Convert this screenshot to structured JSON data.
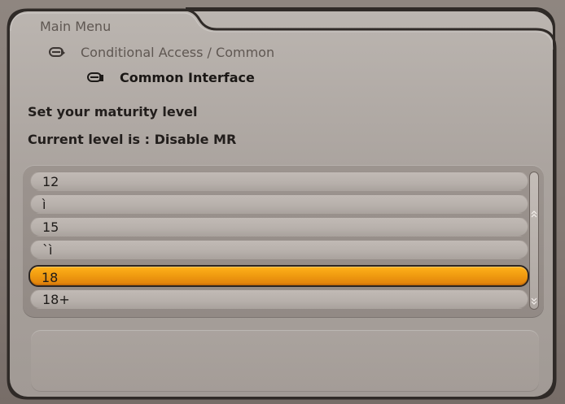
{
  "breadcrumb": {
    "items": [
      {
        "label": "Main Menu"
      },
      {
        "label": "Conditional Access / Common"
      },
      {
        "label": "Common Interface"
      }
    ]
  },
  "prompt": {
    "title": "Set your maturity level",
    "current": "Current level is : Disable MR"
  },
  "levels": {
    "items": [
      {
        "label": "12",
        "selected": false
      },
      {
        "label": "ì",
        "selected": false
      },
      {
        "label": "15",
        "selected": false
      },
      {
        "label": "`ì",
        "selected": false
      },
      {
        "label": "18",
        "selected": true
      },
      {
        "label": "18+",
        "selected": false
      }
    ]
  },
  "icons": {
    "crumb": "return-arrow-icon",
    "scroll_up": "double-up-arrow-icon",
    "scroll_down": "double-down-arrow-icon"
  },
  "colors": {
    "selected": "#f09b10",
    "panel": "#b5aea9",
    "frame": "#2f2a27"
  }
}
